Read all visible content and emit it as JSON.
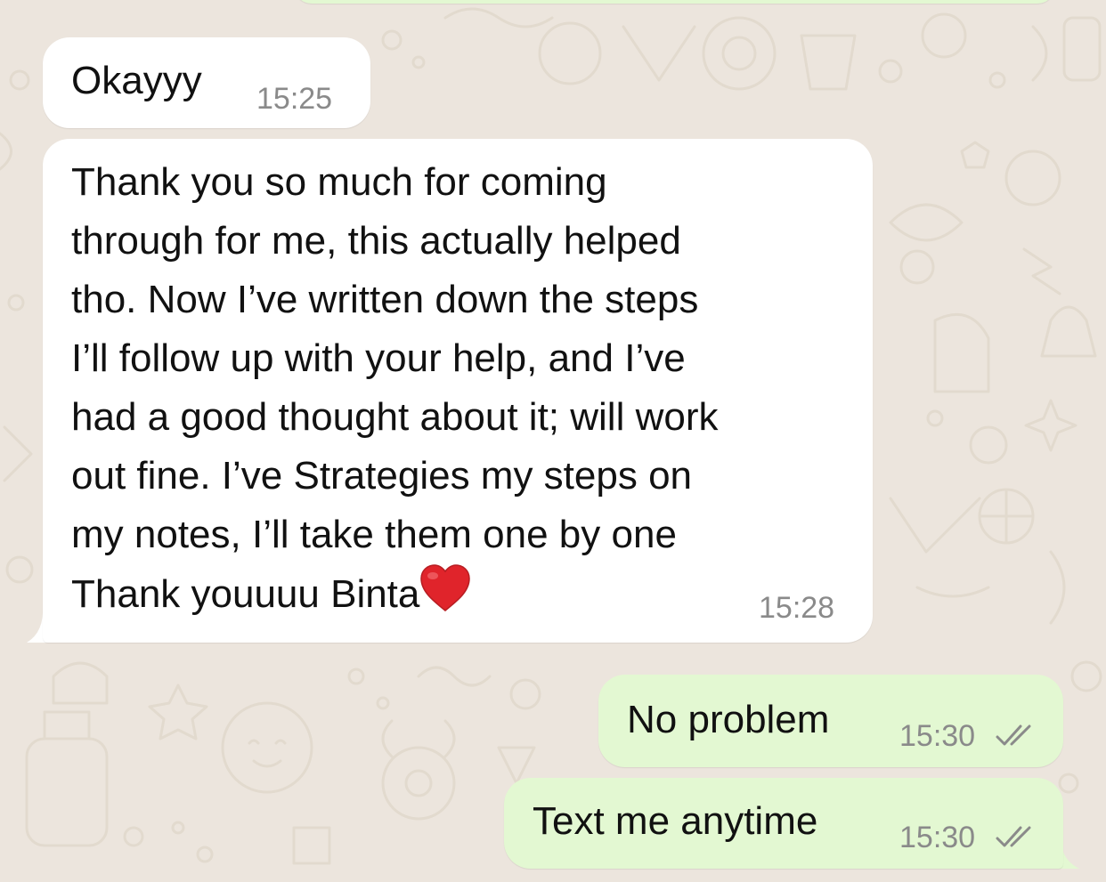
{
  "theme": {
    "wallpaper": "#ece5dd",
    "incoming_bubble": "#ffffff",
    "outgoing_bubble": "#e3f8d2",
    "timestamp_color": "#8a8a8a",
    "tick_color": "#8a8a8a",
    "heart_color": "#e0242b"
  },
  "messages": [
    {
      "direction": "incoming",
      "text": "Okayyy",
      "time": "15:25"
    },
    {
      "direction": "incoming",
      "text": "Thank you so much for coming\nthrough for me, this actually helped\ntho. Now I’ve written down the steps\nI’ll follow up with your help, and I’ve\nhad a good thought about it; will work\nout fine. I’ve Strategies my steps on\nmy notes, I’ll take them one by one\nThank youuuu Binta",
      "emoji": "red-heart-emoji",
      "time": "15:28"
    },
    {
      "direction": "outgoing",
      "text": "No problem",
      "time": "15:30",
      "status": "double-check-read-icon"
    },
    {
      "direction": "outgoing",
      "text": "Text me anytime",
      "time": "15:30",
      "status": "double-check-read-icon"
    }
  ]
}
